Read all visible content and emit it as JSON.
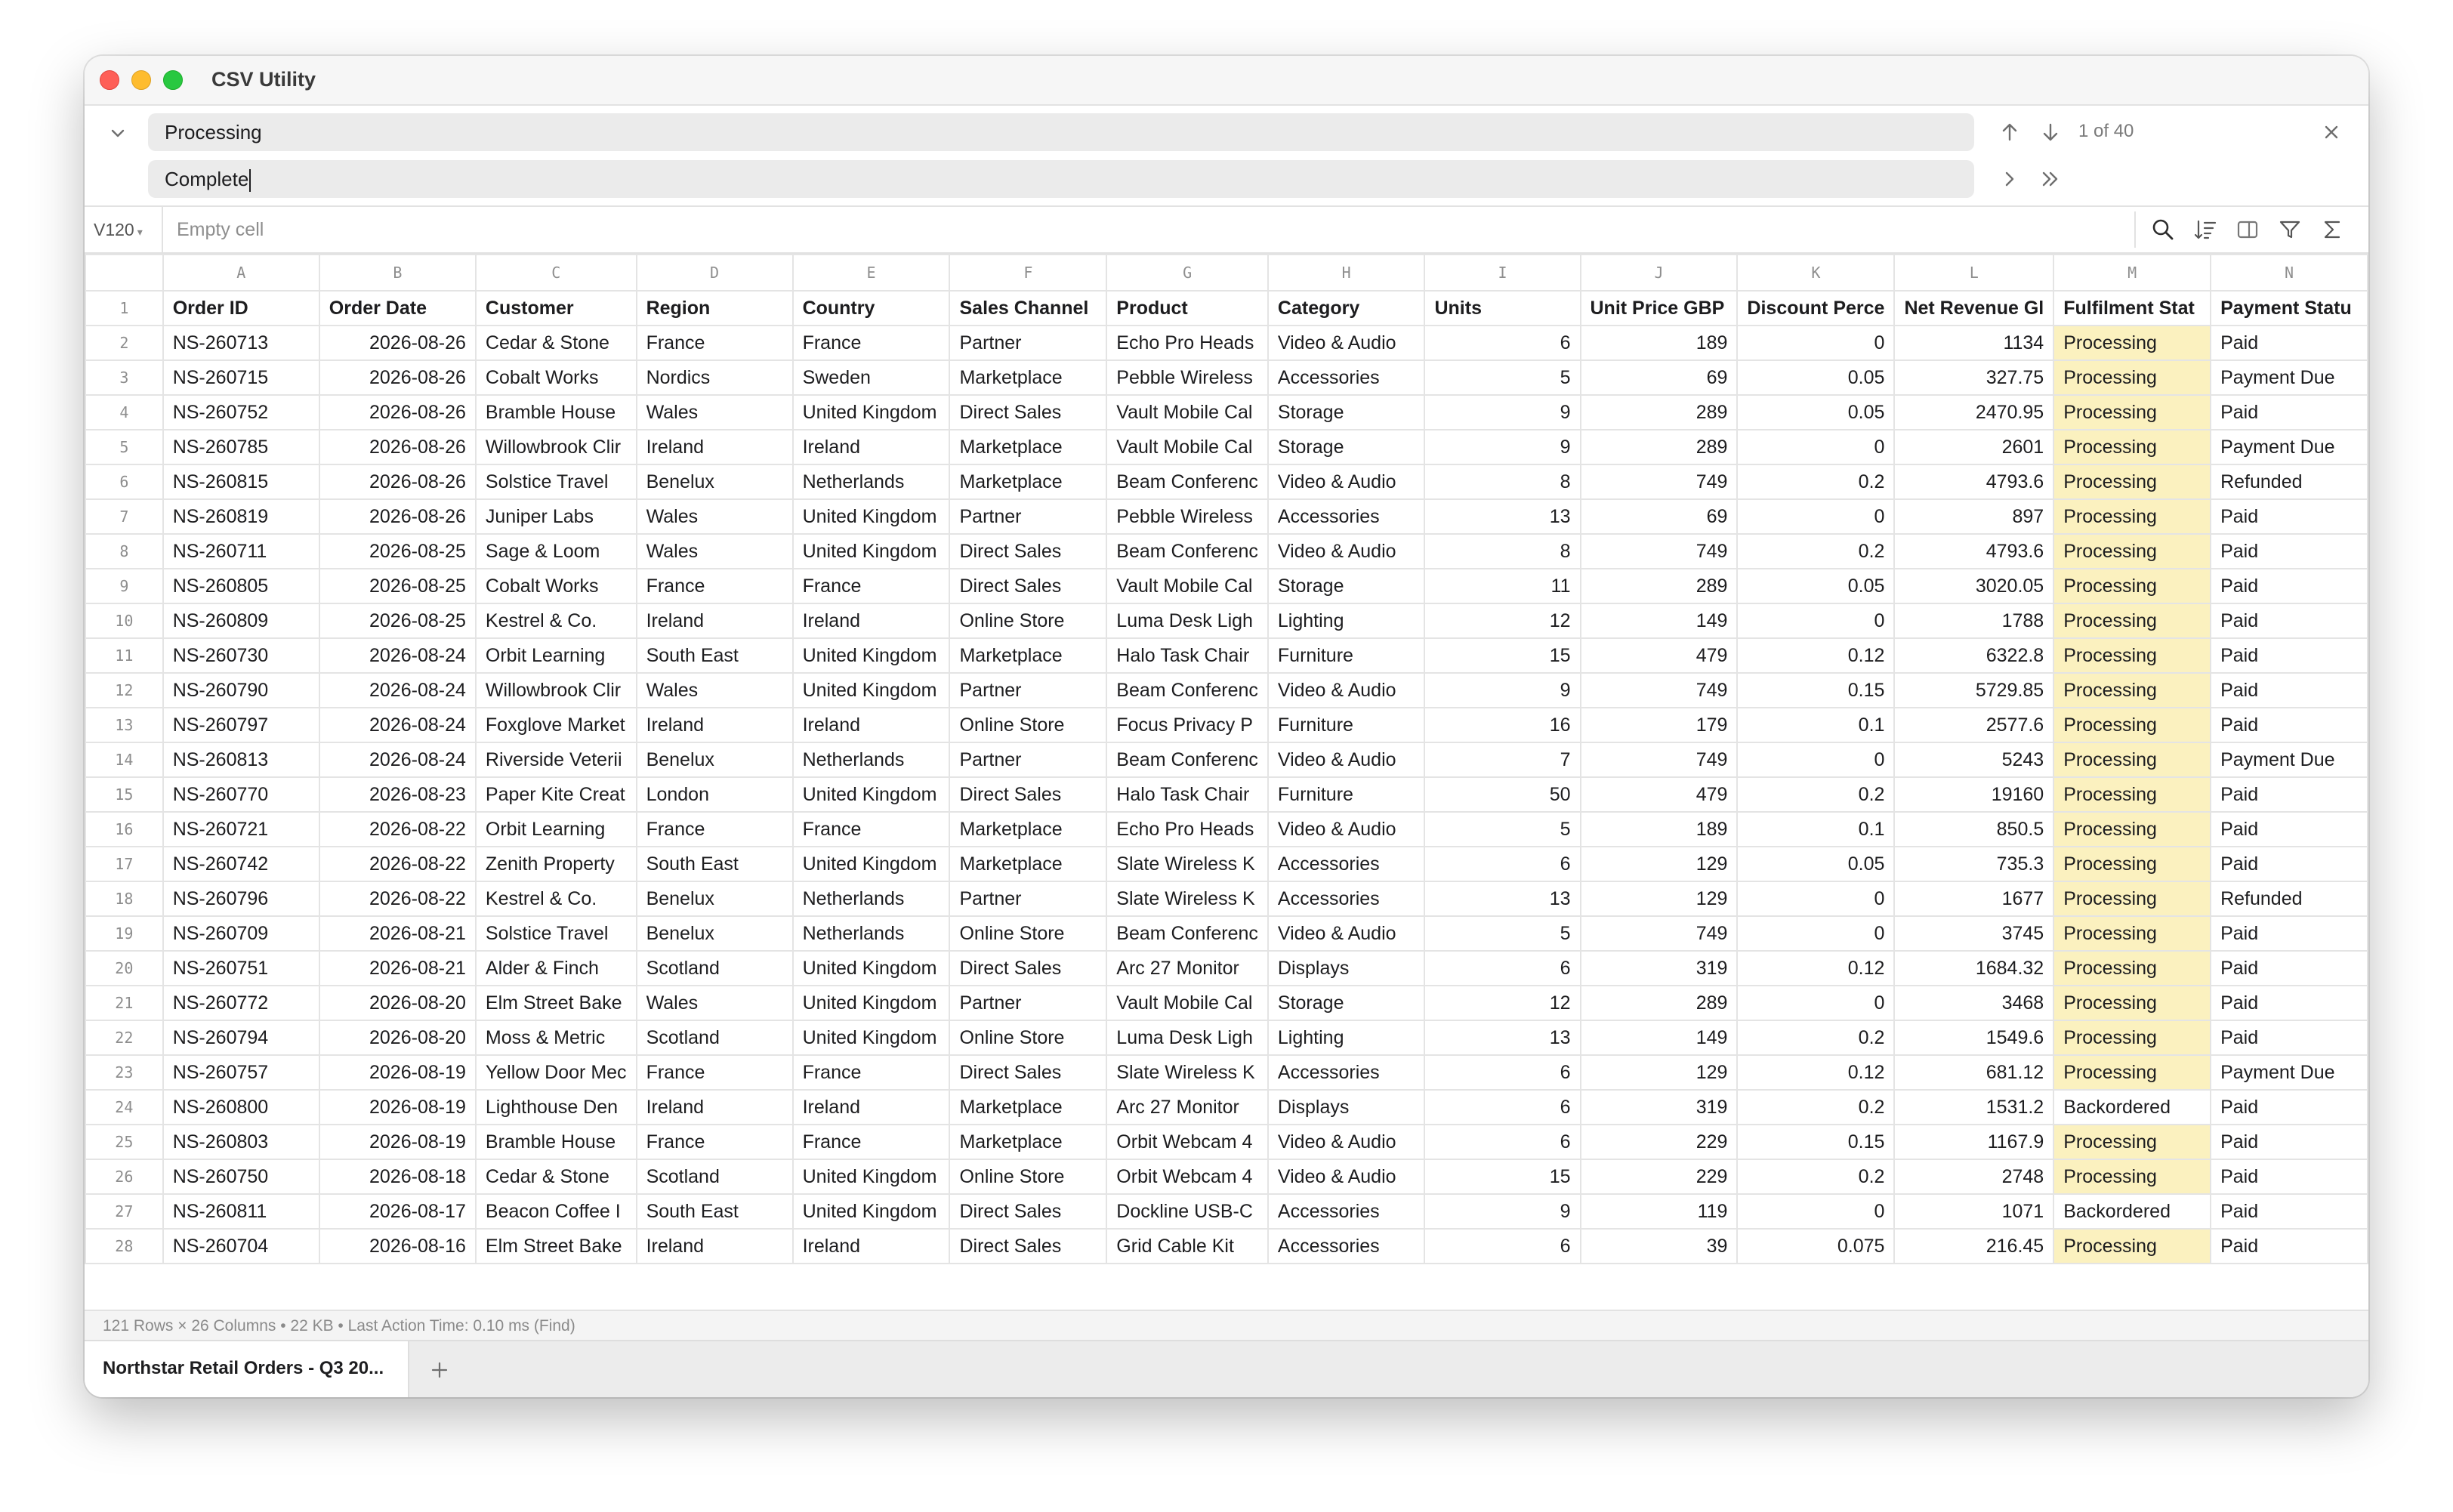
{
  "window": {
    "title": "CSV Utility"
  },
  "find": {
    "find_value": "Processing",
    "replace_value": "Complete",
    "match_count": "1 of 40"
  },
  "formula": {
    "cell_ref": "V120",
    "cell_value": "Empty cell"
  },
  "grid": {
    "column_letters": [
      "A",
      "B",
      "C",
      "D",
      "E",
      "F",
      "G",
      "H",
      "I",
      "J",
      "K",
      "L",
      "M",
      "N"
    ],
    "headers": [
      "Order ID",
      "Order Date",
      "Customer",
      "Region",
      "Country",
      "Sales Channel",
      "Product",
      "Category",
      "Units",
      "Unit Price GBP",
      "Discount Perce",
      "Net Revenue Gl",
      "Fulfilment Stat",
      "Payment Statu"
    ],
    "rows": [
      [
        "2",
        "NS-260713",
        "2026-08-26",
        "Cedar & Stone",
        "France",
        "France",
        "Partner",
        "Echo Pro Heads",
        "Video & Audio",
        "6",
        "189",
        "0",
        "1134",
        "Processing",
        "Paid"
      ],
      [
        "3",
        "NS-260715",
        "2026-08-26",
        "Cobalt Works",
        "Nordics",
        "Sweden",
        "Marketplace",
        "Pebble Wireless",
        "Accessories",
        "5",
        "69",
        "0.05",
        "327.75",
        "Processing",
        "Payment Due"
      ],
      [
        "4",
        "NS-260752",
        "2026-08-26",
        "Bramble House",
        "Wales",
        "United Kingdom",
        "Direct Sales",
        "Vault Mobile Cal",
        "Storage",
        "9",
        "289",
        "0.05",
        "2470.95",
        "Processing",
        "Paid"
      ],
      [
        "5",
        "NS-260785",
        "2026-08-26",
        "Willowbrook Clir",
        "Ireland",
        "Ireland",
        "Marketplace",
        "Vault Mobile Cal",
        "Storage",
        "9",
        "289",
        "0",
        "2601",
        "Processing",
        "Payment Due"
      ],
      [
        "6",
        "NS-260815",
        "2026-08-26",
        "Solstice Travel",
        "Benelux",
        "Netherlands",
        "Marketplace",
        "Beam Conferenc",
        "Video & Audio",
        "8",
        "749",
        "0.2",
        "4793.6",
        "Processing",
        "Refunded"
      ],
      [
        "7",
        "NS-260819",
        "2026-08-26",
        "Juniper Labs",
        "Wales",
        "United Kingdom",
        "Partner",
        "Pebble Wireless",
        "Accessories",
        "13",
        "69",
        "0",
        "897",
        "Processing",
        "Paid"
      ],
      [
        "8",
        "NS-260711",
        "2026-08-25",
        "Sage & Loom",
        "Wales",
        "United Kingdom",
        "Direct Sales",
        "Beam Conferenc",
        "Video & Audio",
        "8",
        "749",
        "0.2",
        "4793.6",
        "Processing",
        "Paid"
      ],
      [
        "9",
        "NS-260805",
        "2026-08-25",
        "Cobalt Works",
        "France",
        "France",
        "Direct Sales",
        "Vault Mobile Cal",
        "Storage",
        "11",
        "289",
        "0.05",
        "3020.05",
        "Processing",
        "Paid"
      ],
      [
        "10",
        "NS-260809",
        "2026-08-25",
        "Kestrel & Co.",
        "Ireland",
        "Ireland",
        "Online Store",
        "Luma Desk Ligh",
        "Lighting",
        "12",
        "149",
        "0",
        "1788",
        "Processing",
        "Paid"
      ],
      [
        "11",
        "NS-260730",
        "2026-08-24",
        "Orbit Learning",
        "South East",
        "United Kingdom",
        "Marketplace",
        "Halo Task Chair",
        "Furniture",
        "15",
        "479",
        "0.12",
        "6322.8",
        "Processing",
        "Paid"
      ],
      [
        "12",
        "NS-260790",
        "2026-08-24",
        "Willowbrook Clir",
        "Wales",
        "United Kingdom",
        "Partner",
        "Beam Conferenc",
        "Video & Audio",
        "9",
        "749",
        "0.15",
        "5729.85",
        "Processing",
        "Paid"
      ],
      [
        "13",
        "NS-260797",
        "2026-08-24",
        "Foxglove Market",
        "Ireland",
        "Ireland",
        "Online Store",
        "Focus Privacy P",
        "Furniture",
        "16",
        "179",
        "0.1",
        "2577.6",
        "Processing",
        "Paid"
      ],
      [
        "14",
        "NS-260813",
        "2026-08-24",
        "Riverside Veterii",
        "Benelux",
        "Netherlands",
        "Partner",
        "Beam Conferenc",
        "Video & Audio",
        "7",
        "749",
        "0",
        "5243",
        "Processing",
        "Payment Due"
      ],
      [
        "15",
        "NS-260770",
        "2026-08-23",
        "Paper Kite Creat",
        "London",
        "United Kingdom",
        "Direct Sales",
        "Halo Task Chair",
        "Furniture",
        "50",
        "479",
        "0.2",
        "19160",
        "Processing",
        "Paid"
      ],
      [
        "16",
        "NS-260721",
        "2026-08-22",
        "Orbit Learning",
        "France",
        "France",
        "Marketplace",
        "Echo Pro Heads",
        "Video & Audio",
        "5",
        "189",
        "0.1",
        "850.5",
        "Processing",
        "Paid"
      ],
      [
        "17",
        "NS-260742",
        "2026-08-22",
        "Zenith Property",
        "South East",
        "United Kingdom",
        "Marketplace",
        "Slate Wireless K",
        "Accessories",
        "6",
        "129",
        "0.05",
        "735.3",
        "Processing",
        "Paid"
      ],
      [
        "18",
        "NS-260796",
        "2026-08-22",
        "Kestrel & Co.",
        "Benelux",
        "Netherlands",
        "Partner",
        "Slate Wireless K",
        "Accessories",
        "13",
        "129",
        "0",
        "1677",
        "Processing",
        "Refunded"
      ],
      [
        "19",
        "NS-260709",
        "2026-08-21",
        "Solstice Travel",
        "Benelux",
        "Netherlands",
        "Online Store",
        "Beam Conferenc",
        "Video & Audio",
        "5",
        "749",
        "0",
        "3745",
        "Processing",
        "Paid"
      ],
      [
        "20",
        "NS-260751",
        "2026-08-21",
        "Alder & Finch",
        "Scotland",
        "United Kingdom",
        "Direct Sales",
        "Arc 27 Monitor",
        "Displays",
        "6",
        "319",
        "0.12",
        "1684.32",
        "Processing",
        "Paid"
      ],
      [
        "21",
        "NS-260772",
        "2026-08-20",
        "Elm Street Bake",
        "Wales",
        "United Kingdom",
        "Partner",
        "Vault Mobile Cal",
        "Storage",
        "12",
        "289",
        "0",
        "3468",
        "Processing",
        "Paid"
      ],
      [
        "22",
        "NS-260794",
        "2026-08-20",
        "Moss & Metric",
        "Scotland",
        "United Kingdom",
        "Online Store",
        "Luma Desk Ligh",
        "Lighting",
        "13",
        "149",
        "0.2",
        "1549.6",
        "Processing",
        "Paid"
      ],
      [
        "23",
        "NS-260757",
        "2026-08-19",
        "Yellow Door Mec",
        "France",
        "France",
        "Direct Sales",
        "Slate Wireless K",
        "Accessories",
        "6",
        "129",
        "0.12",
        "681.12",
        "Processing",
        "Payment Due"
      ],
      [
        "24",
        "NS-260800",
        "2026-08-19",
        "Lighthouse Den",
        "Ireland",
        "Ireland",
        "Marketplace",
        "Arc 27 Monitor",
        "Displays",
        "6",
        "319",
        "0.2",
        "1531.2",
        "Backordered",
        "Paid"
      ],
      [
        "25",
        "NS-260803",
        "2026-08-19",
        "Bramble House",
        "France",
        "France",
        "Marketplace",
        "Orbit Webcam 4",
        "Video & Audio",
        "6",
        "229",
        "0.15",
        "1167.9",
        "Processing",
        "Paid"
      ],
      [
        "26",
        "NS-260750",
        "2026-08-18",
        "Cedar & Stone",
        "Scotland",
        "United Kingdom",
        "Online Store",
        "Orbit Webcam 4",
        "Video & Audio",
        "15",
        "229",
        "0.2",
        "2748",
        "Processing",
        "Paid"
      ],
      [
        "27",
        "NS-260811",
        "2026-08-17",
        "Beacon Coffee I",
        "South East",
        "United Kingdom",
        "Direct Sales",
        "Dockline USB-C",
        "Accessories",
        "9",
        "119",
        "0",
        "1071",
        "Backordered",
        "Paid"
      ],
      [
        "28",
        "NS-260704",
        "2026-08-16",
        "Elm Street Bake",
        "Ireland",
        "Ireland",
        "Direct Sales",
        "Grid Cable Kit",
        "Accessories",
        "6",
        "39",
        "0.075",
        "216.45",
        "Processing",
        "Paid"
      ]
    ],
    "highlight_color": "#fbf1bf"
  },
  "status": {
    "text": "121 Rows × 26 Columns • 22 KB • Last Action Time: 0.10 ms (Find)"
  },
  "tabs": {
    "active_label": "Northstar Retail Orders - Q3 20..."
  },
  "icons": {
    "find_collapse": "chevron-down-icon",
    "prev": "arrow-up-icon",
    "next": "arrow-down-icon",
    "close": "close-icon",
    "replace": "chevron-right-icon",
    "replace_all": "double-chevron-right-icon",
    "search": "search-icon",
    "sort": "sort-icon",
    "sidebar": "sidebar-icon",
    "filter": "filter-icon",
    "sum": "sigma-icon",
    "add_tab": "plus-icon"
  }
}
